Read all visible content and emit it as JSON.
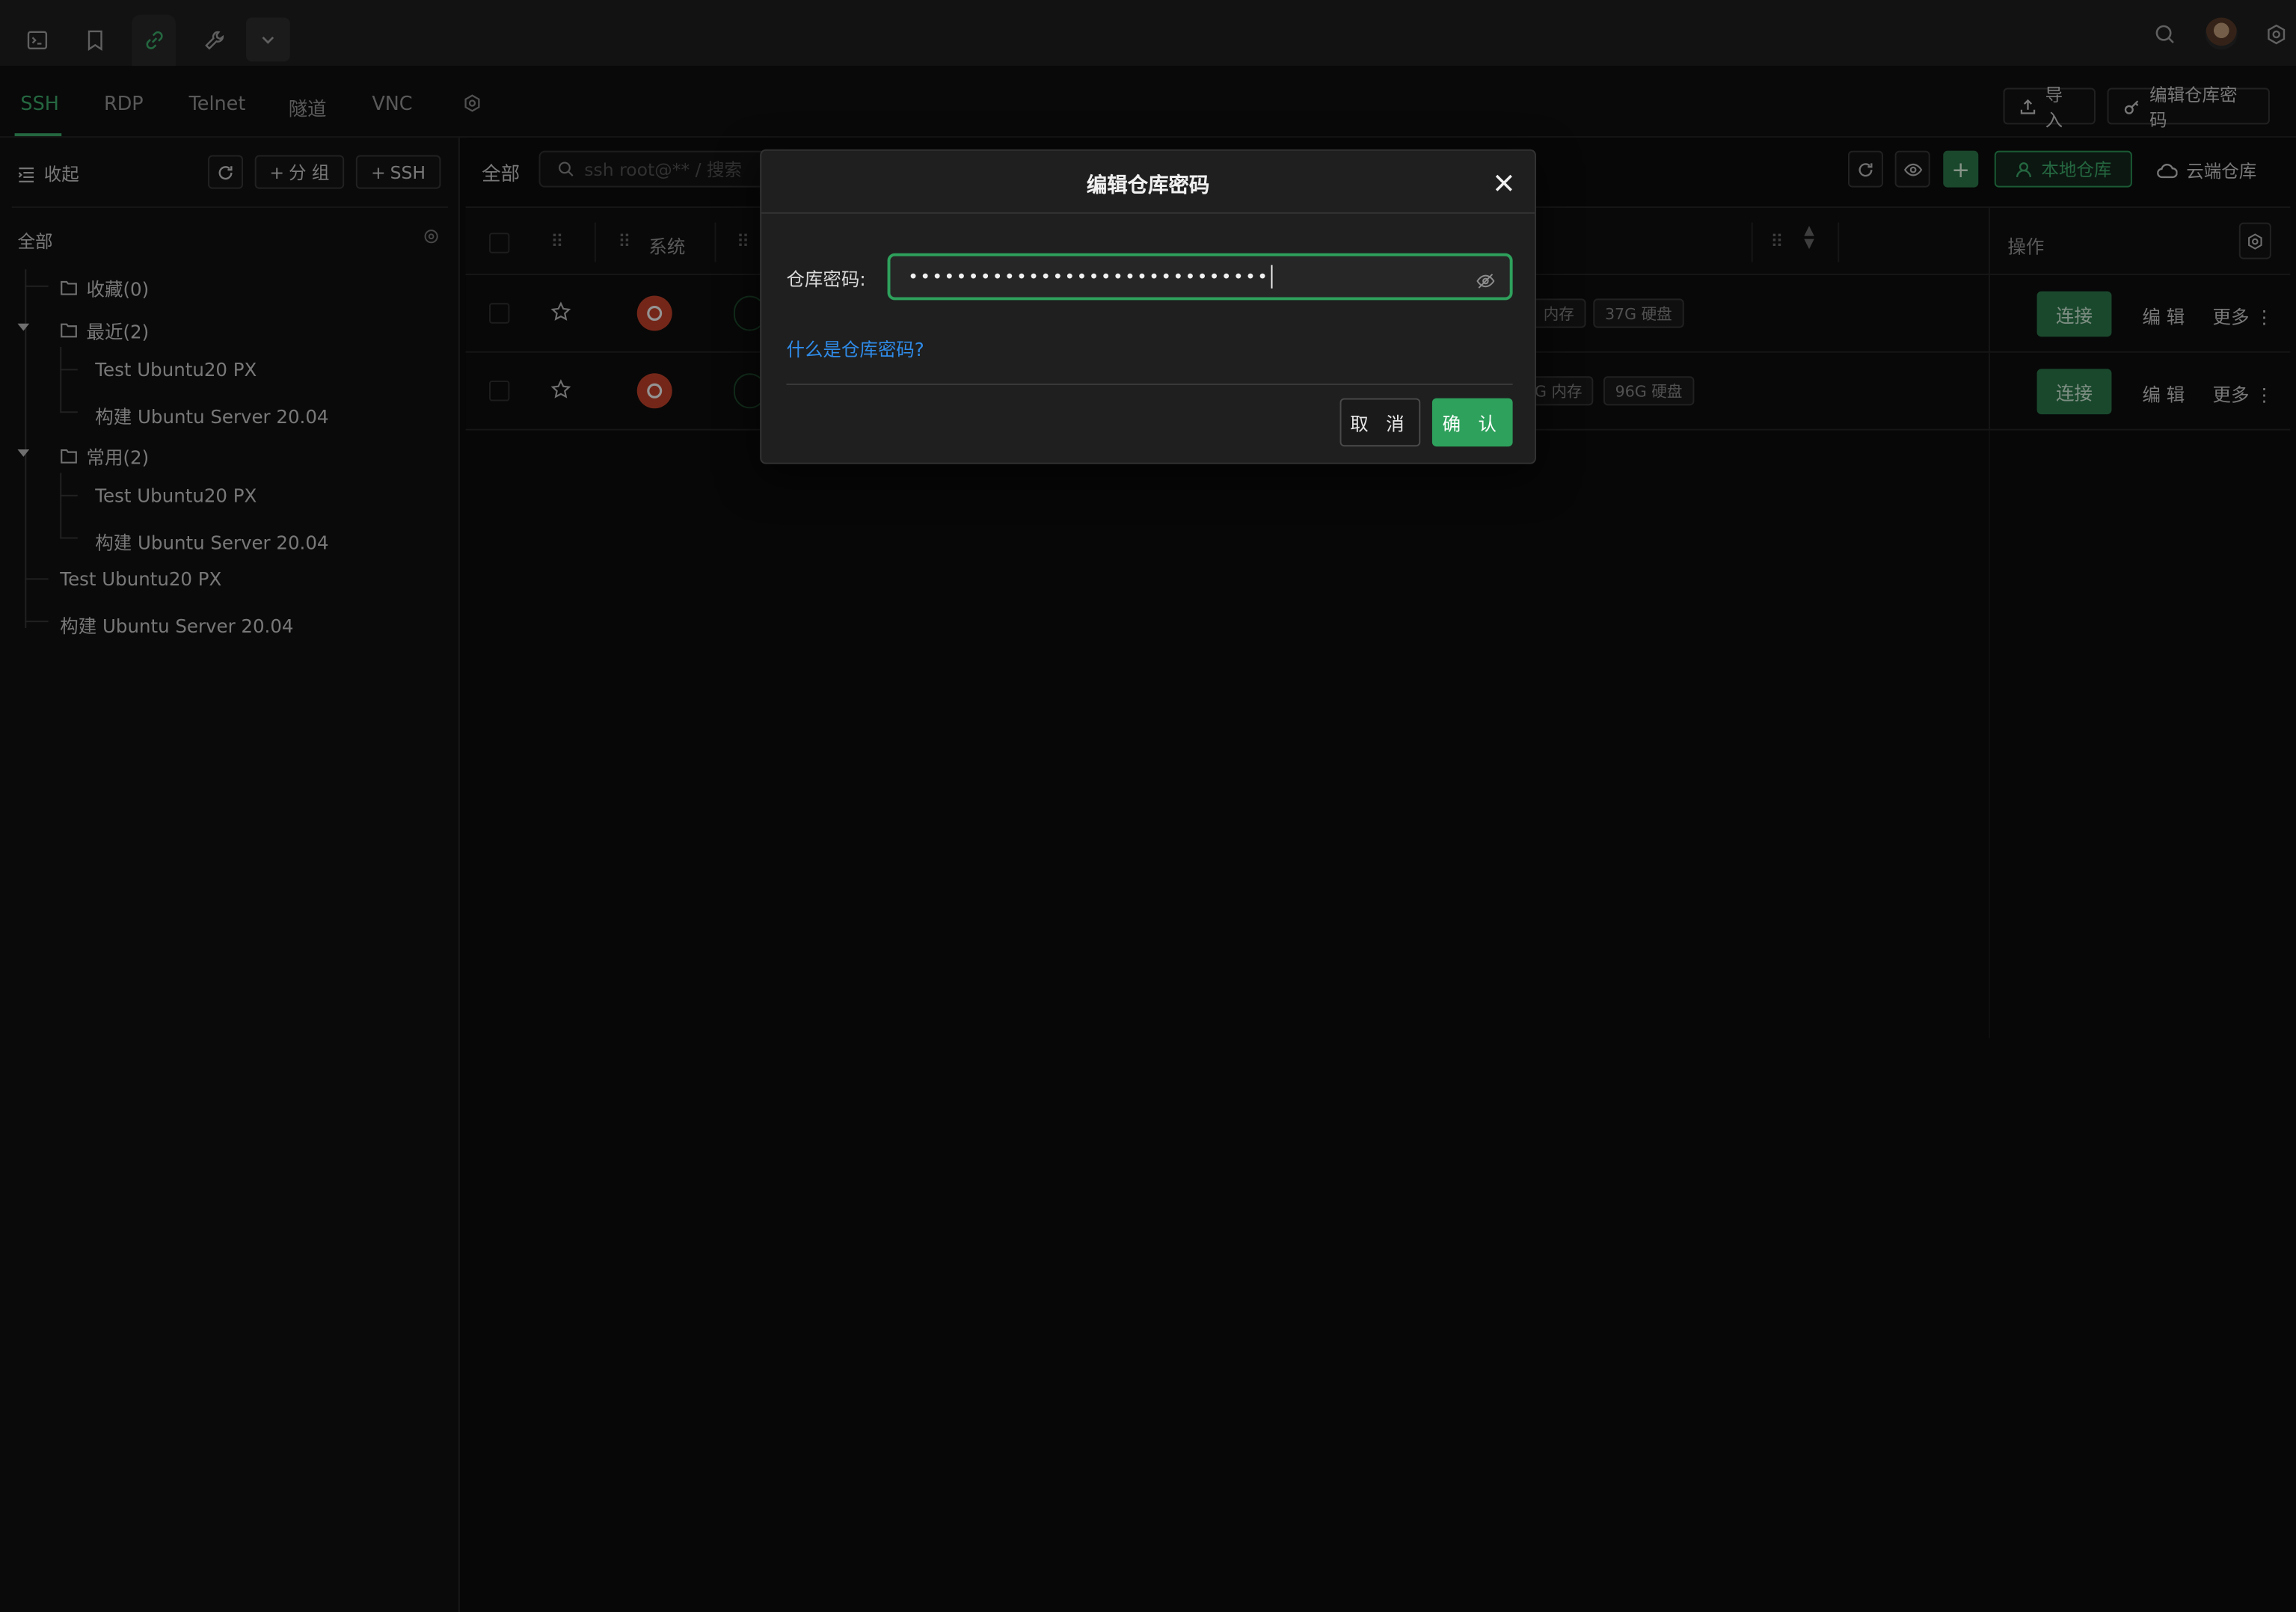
{
  "topbar": {
    "tabs": [
      {
        "icon": "terminal-icon"
      },
      {
        "icon": "bookmark-icon"
      },
      {
        "icon": "link-icon",
        "active": true
      },
      {
        "icon": "wrench-icon"
      },
      {
        "icon": "chevron-down-icon"
      }
    ],
    "right_icons": [
      "search-icon",
      "avatar",
      "gear-icon"
    ]
  },
  "protocol_tabs": {
    "items": [
      "SSH",
      "RDP",
      "Telnet",
      "隧道",
      "VNC"
    ],
    "active": "SSH"
  },
  "header_actions": {
    "import_label": "导入",
    "edit_repo_password_label": "编辑仓库密码"
  },
  "sidebar": {
    "collapse_label": "收起",
    "add_group_label": "分 组",
    "add_ssh_label": "SSH",
    "all_label": "全部",
    "favorites": "收藏(0)",
    "recent": {
      "label": "最近(2)",
      "items": [
        "Test Ubuntu20 PX",
        "构建 Ubuntu Server 20.04"
      ]
    },
    "common": {
      "label": "常用(2)",
      "items": [
        "Test Ubuntu20 PX",
        "构建 Ubuntu Server 20.04"
      ]
    },
    "loose_items": [
      "Test Ubuntu20 PX",
      "构建 Ubuntu Server 20.04"
    ]
  },
  "main": {
    "filter_label": "全部",
    "search_placeholder": "ssh root@** / 搜索",
    "local_repo_label": "本地仓库",
    "cloud_repo_label": "云端仓库",
    "table": {
      "headers": {
        "system": "系统",
        "actions": "操作"
      },
      "rows": [
        {
          "memory_tag": "内存",
          "disk_tag": "37G 硬盘",
          "connect": "连接",
          "edit": "编 辑",
          "more": "更多"
        },
        {
          "memory_tag": "G 内存",
          "disk_tag": "96G 硬盘",
          "connect": "连接",
          "edit": "编 辑",
          "more": "更多"
        }
      ]
    }
  },
  "modal": {
    "title": "编辑仓库密码",
    "password_label": "仓库密码:",
    "password_value": "••••••••••••••••••••••••••••••",
    "help_link": "什么是仓库密码?",
    "cancel_label": "取 消",
    "confirm_label": "确 认"
  },
  "colors": {
    "accent": "#2ea15c",
    "link": "#2f8be8",
    "background": "#0d0d0d"
  }
}
